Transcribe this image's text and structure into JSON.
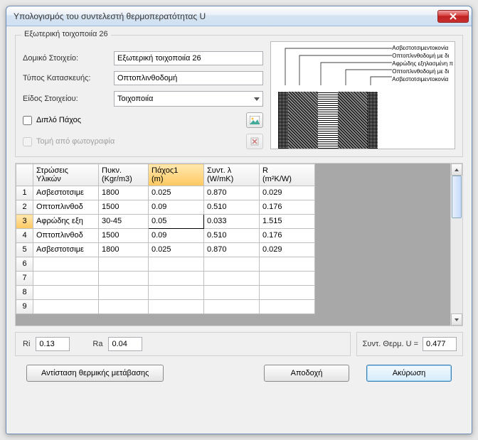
{
  "window": {
    "title": "Υπολογισμός του συντελεστή θερμοπερατότητας U"
  },
  "group": {
    "title": "Εξωτερική τοιχοποιία 26"
  },
  "form": {
    "element_label": "Δομικό Στοιχείο:",
    "element_value": "Εξωτερική τοιχοποιία 26",
    "construction_label": "Τύπος Κατασκευής:",
    "construction_value": "Οπτοπλινθοδομή",
    "kind_label": "Είδος Στοιχείου:",
    "kind_value": "Τοιχοποιία",
    "double_label": "Διπλό Πάχος",
    "photo_label": "Τομή από φωτογραφία"
  },
  "sketch_labels": [
    "Ασβεστοτσιμεντοκονία",
    "Οπτοπλινθοδομή με δι",
    "Αφρώδης εξηλασμένη π",
    "Οπτοπλινθοδομή με δι",
    "Ασβεστοτσιμεντοκονία"
  ],
  "grid": {
    "headers": {
      "row": "",
      "material": "Στρώσεις\nΥλικών",
      "density": "Πυκν.\n(Kgr/m3)",
      "thickness": "Πάχος1\n(m)",
      "lambda": "Συντ. λ\n(W/mK)",
      "r": "R\n(m²K/W)"
    },
    "rows": [
      {
        "n": "1",
        "mat": "Ασβεστοτσιμε",
        "dens": "1800",
        "thick": "0.025",
        "lambda": "0.870",
        "r": "0.029"
      },
      {
        "n": "2",
        "mat": "Οπτοπλινθοδ",
        "dens": "1500",
        "thick": "0.09",
        "lambda": "0.510",
        "r": "0.176"
      },
      {
        "n": "3",
        "mat": "Αφρώδης εξη",
        "dens": "30-45",
        "thick": "0.05",
        "lambda": "0.033",
        "r": "1.515"
      },
      {
        "n": "4",
        "mat": "Οπτοπλινθοδ",
        "dens": "1500",
        "thick": "0.09",
        "lambda": "0.510",
        "r": "0.176"
      },
      {
        "n": "5",
        "mat": "Ασβεστοτσιμε",
        "dens": "1800",
        "thick": "0.025",
        "lambda": "0.870",
        "r": "0.029"
      },
      {
        "n": "6",
        "mat": "",
        "dens": "",
        "thick": "",
        "lambda": "",
        "r": ""
      },
      {
        "n": "7",
        "mat": "",
        "dens": "",
        "thick": "",
        "lambda": "",
        "r": ""
      },
      {
        "n": "8",
        "mat": "",
        "dens": "",
        "thick": "",
        "lambda": "",
        "r": ""
      },
      {
        "n": "9",
        "mat": "",
        "dens": "",
        "thick": "",
        "lambda": "",
        "r": ""
      }
    ]
  },
  "bottom": {
    "ri_label": "Ri",
    "ri_value": "0.13",
    "ra_label": "Ra",
    "ra_value": "0.04",
    "u_label": "Συντ. Θερμ. U =",
    "u_value": "0.477"
  },
  "buttons": {
    "resistance": "Αντίσταση θερμικής μετάβασης",
    "accept": "Αποδοχή",
    "cancel": "Ακύρωση"
  }
}
